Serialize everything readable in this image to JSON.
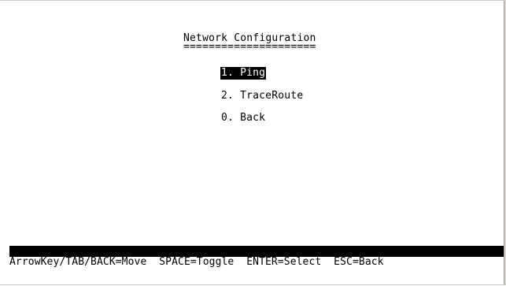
{
  "screen": {
    "title": "Network Configuration",
    "title_underline": "====================="
  },
  "menu": {
    "items": [
      {
        "label": "1. Ping",
        "selected": true
      },
      {
        "label": "2. TraceRoute",
        "selected": false
      },
      {
        "label": "0. Back",
        "selected": false
      }
    ]
  },
  "help": {
    "text": "ArrowKey/TAB/BACK=Move  SPACE=Toggle  ENTER=Select  ESC=Back"
  },
  "colors": {
    "background": "#ffffff",
    "foreground": "#000000",
    "highlight_bg": "#000000",
    "highlight_fg": "#ffffff"
  }
}
